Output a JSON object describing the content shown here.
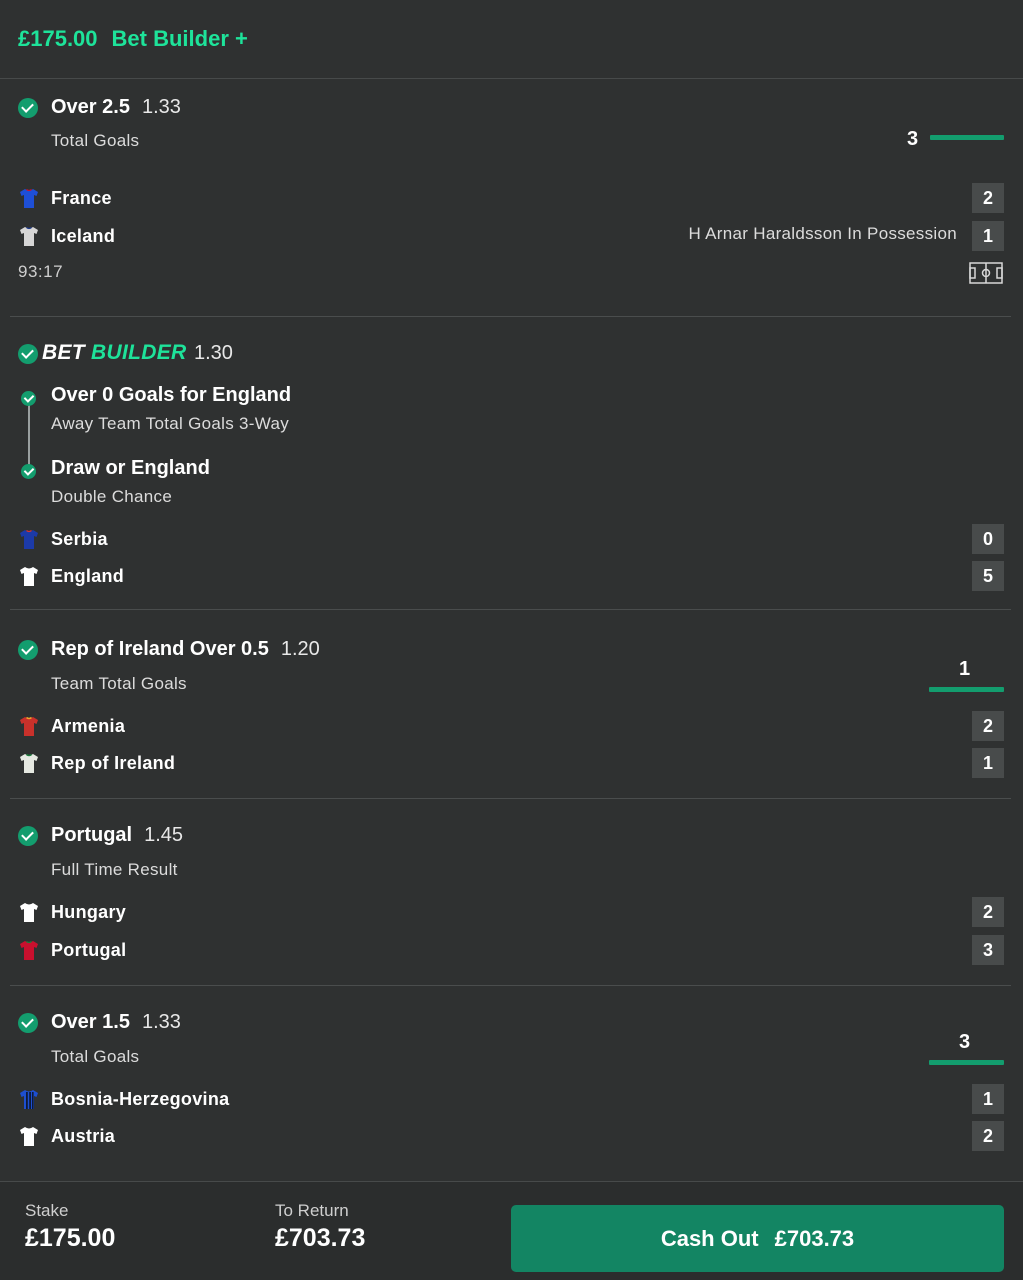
{
  "header": {
    "amount": "£175.00",
    "title": "Bet Builder +"
  },
  "colors": {
    "accent": "#1ee39a",
    "check": "#139d6e",
    "cashout": "#138563",
    "background": "#2f3131"
  },
  "selections": [
    {
      "title": "Over 2.5",
      "odds": "1.33",
      "market": "Total Goals",
      "progress": "3",
      "progress_fraction": 1.0,
      "teams": [
        {
          "name": "France",
          "score": "2",
          "shirt": "blue-shirt-icon"
        },
        {
          "name": "Iceland",
          "score": "1",
          "shirt": "white-shirt-icon"
        }
      ],
      "status": "H Arnar Haraldsson In Possession",
      "clock": "93:17"
    },
    {
      "logo_part1": "BET",
      "logo_part2": "BUILDER",
      "odds": "1.30",
      "legs": [
        {
          "title": "Over 0 Goals for England",
          "market": "Away Team Total Goals 3-Way"
        },
        {
          "title": "Draw or England",
          "market": "Double Chance"
        }
      ],
      "teams": [
        {
          "name": "Serbia",
          "score": "0",
          "shirt": "navy-shirt-icon"
        },
        {
          "name": "England",
          "score": "5",
          "shirt": "white-shirt-icon"
        }
      ]
    },
    {
      "title": "Rep of Ireland Over 0.5",
      "odds": "1.20",
      "market": "Team Total Goals",
      "progress": "1",
      "progress_fraction": 1.0,
      "teams": [
        {
          "name": "Armenia",
          "score": "2",
          "shirt": "red-shirt-icon"
        },
        {
          "name": "Rep of Ireland",
          "score": "1",
          "shirt": "white-green-shirt-icon"
        }
      ]
    },
    {
      "title": "Portugal",
      "odds": "1.45",
      "market": "Full Time Result",
      "teams": [
        {
          "name": "Hungary",
          "score": "2",
          "shirt": "white-shirt-icon"
        },
        {
          "name": "Portugal",
          "score": "3",
          "shirt": "red-shirt-icon"
        }
      ]
    },
    {
      "title": "Over 1.5",
      "odds": "1.33",
      "market": "Total Goals",
      "progress": "3",
      "progress_fraction": 1.0,
      "teams": [
        {
          "name": "Bosnia-Herzegovina",
          "score": "1",
          "shirt": "blue-striped-shirt-icon"
        },
        {
          "name": "Austria",
          "score": "2",
          "shirt": "white-shirt-icon"
        }
      ]
    }
  ],
  "footer": {
    "stake_label": "Stake",
    "stake_value": "£175.00",
    "return_label": "To Return",
    "return_value": "£703.73",
    "cashout_label": "Cash Out",
    "cashout_amount": "£703.73"
  }
}
